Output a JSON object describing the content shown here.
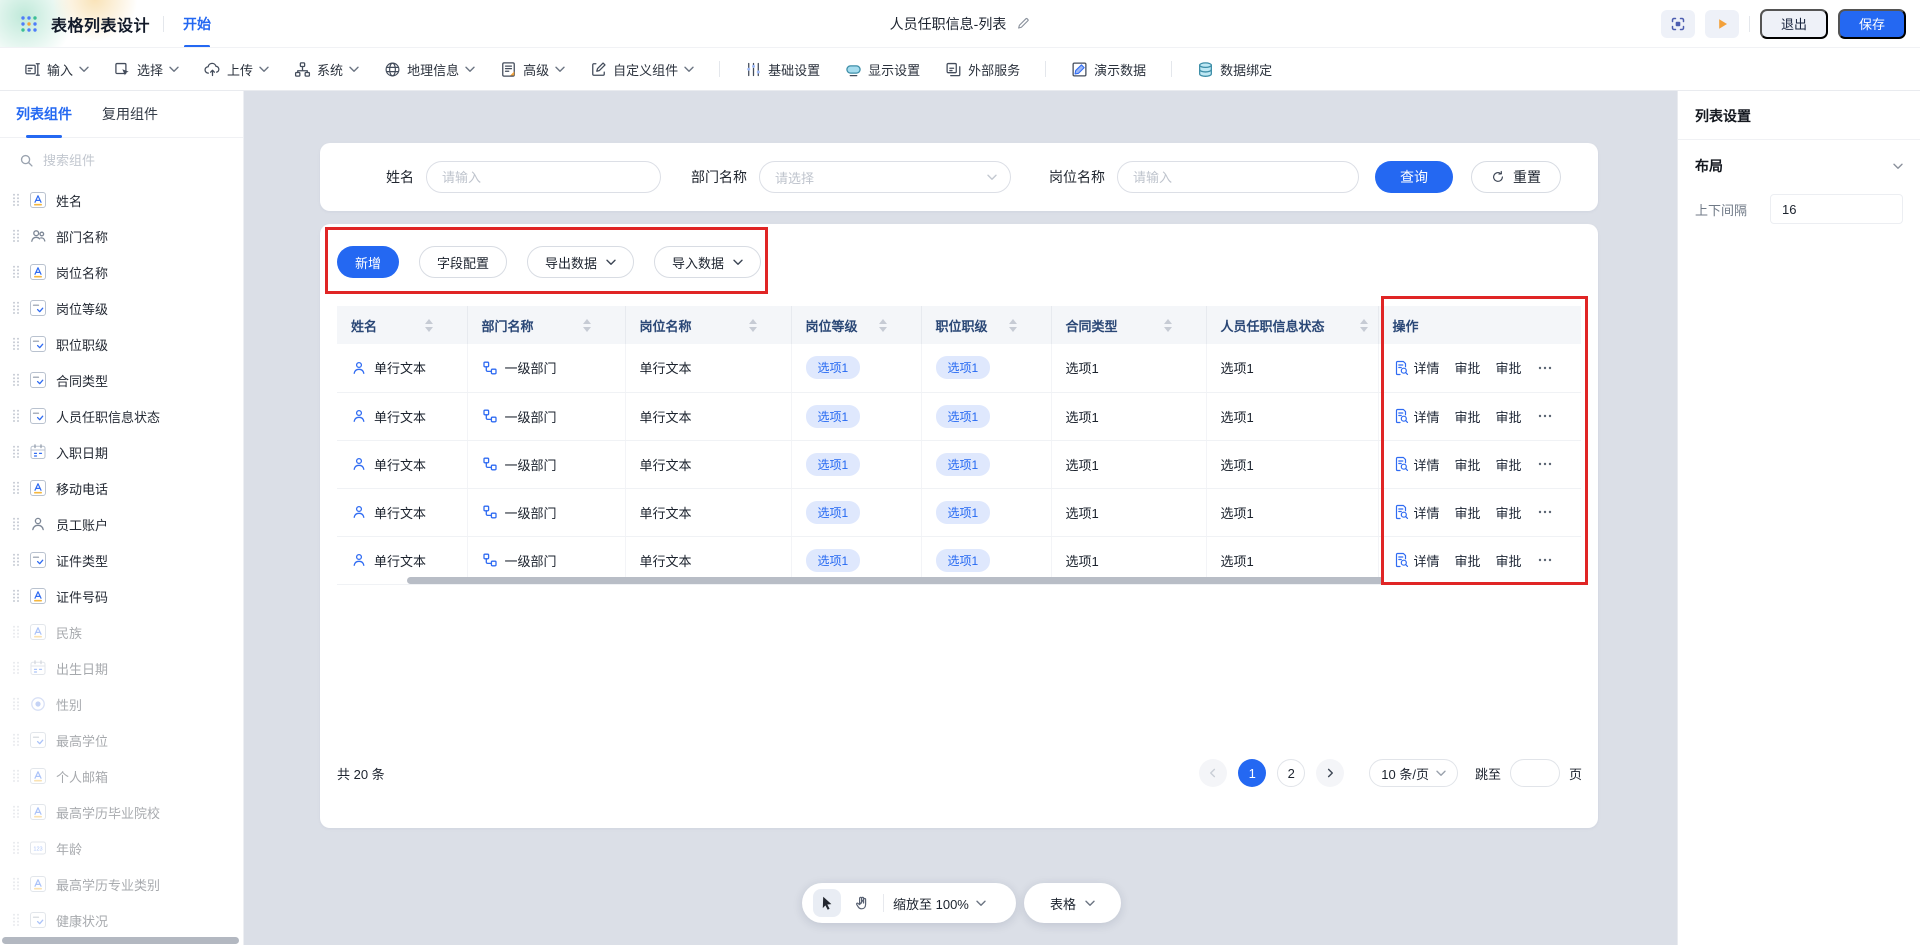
{
  "brand": {
    "app_title": "表格列表设计",
    "start_tab": "开始"
  },
  "header": {
    "doc_title": "人员任职信息-列表",
    "exit": "退出",
    "save": "保存"
  },
  "accent_color": "#2468f2",
  "annotation_color": "#e02525",
  "toolbar": {
    "items": [
      {
        "label": "输入",
        "icon": "t_input",
        "caret": true
      },
      {
        "label": "选择",
        "icon": "t_select",
        "caret": true
      },
      {
        "label": "上传",
        "icon": "t_upload",
        "caret": true
      },
      {
        "label": "系统",
        "icon": "t_system",
        "caret": true
      },
      {
        "label": "地理信息",
        "icon": "t_geo",
        "caret": true
      },
      {
        "label": "高级",
        "icon": "t_advanced",
        "caret": true
      },
      {
        "label": "自定义组件",
        "icon": "t_custom",
        "caret": true
      },
      {
        "label": "基础设置",
        "icon": "t_basic",
        "caret": false
      },
      {
        "label": "显示设置",
        "icon": "t_display",
        "caret": false
      },
      {
        "label": "外部服务",
        "icon": "t_external",
        "caret": false
      },
      {
        "label": "演示数据",
        "icon": "t_demo",
        "caret": false
      },
      {
        "label": "数据绑定",
        "icon": "t_databind",
        "caret": false
      }
    ]
  },
  "sidebar": {
    "tabs": [
      {
        "label": "列表组件",
        "active": true
      },
      {
        "label": "复用组件",
        "active": false
      }
    ],
    "search_placeholder": "搜索组件",
    "items": [
      {
        "label": "姓名",
        "icon": "text",
        "disabled": false
      },
      {
        "label": "部门名称",
        "icon": "people",
        "disabled": false
      },
      {
        "label": "岗位名称",
        "icon": "text",
        "disabled": false
      },
      {
        "label": "岗位等级",
        "icon": "select",
        "disabled": false
      },
      {
        "label": "职位职级",
        "icon": "select",
        "disabled": false
      },
      {
        "label": "合同类型",
        "icon": "select",
        "disabled": false
      },
      {
        "label": "人员任职信息状态",
        "icon": "select",
        "disabled": false
      },
      {
        "label": "入职日期",
        "icon": "date",
        "disabled": false
      },
      {
        "label": "移动电话",
        "icon": "text",
        "disabled": false
      },
      {
        "label": "员工账户",
        "icon": "person",
        "disabled": false
      },
      {
        "label": "证件类型",
        "icon": "select",
        "disabled": false
      },
      {
        "label": "证件号码",
        "icon": "text",
        "disabled": false
      },
      {
        "label": "民族",
        "icon": "text",
        "disabled": true
      },
      {
        "label": "出生日期",
        "icon": "date",
        "disabled": true
      },
      {
        "label": "性别",
        "icon": "radio",
        "disabled": true
      },
      {
        "label": "最高学位",
        "icon": "select",
        "disabled": true
      },
      {
        "label": "个人邮箱",
        "icon": "text",
        "disabled": true
      },
      {
        "label": "最高学历毕业院校",
        "icon": "text",
        "disabled": true
      },
      {
        "label": "年龄",
        "icon": "number",
        "disabled": true
      },
      {
        "label": "最高学历专业类别",
        "icon": "text",
        "disabled": true
      },
      {
        "label": "健康状况",
        "icon": "select",
        "disabled": true
      }
    ]
  },
  "search_form": {
    "fields": [
      {
        "label": "姓名",
        "placeholder": "请输入",
        "type": "input"
      },
      {
        "label": "部门名称",
        "placeholder": "请选择",
        "type": "select"
      },
      {
        "label": "岗位名称",
        "placeholder": "请输入",
        "type": "input"
      }
    ],
    "query": "查询",
    "reset": "重置"
  },
  "actions_bar": {
    "add": "新增",
    "field_config": "字段配置",
    "export": "导出数据",
    "import": "导入数据"
  },
  "table": {
    "columns": [
      {
        "label": "姓名",
        "sortable": true
      },
      {
        "label": "部门名称",
        "sortable": true
      },
      {
        "label": "岗位名称",
        "sortable": true
      },
      {
        "label": "岗位等级",
        "sortable": true
      },
      {
        "label": "职位职级",
        "sortable": true
      },
      {
        "label": "合同类型",
        "sortable": true
      },
      {
        "label": "人员任职信息状态",
        "sortable": true
      },
      {
        "label": "操作",
        "sortable": false
      }
    ],
    "rows": [
      {
        "name": "单行文本",
        "dept": "一级部门",
        "post": "单行文本",
        "grade": "选项1",
        "rank": "选项1",
        "contract": "选项1",
        "status": "选项1",
        "actions": [
          "详情",
          "审批",
          "审批"
        ]
      },
      {
        "name": "单行文本",
        "dept": "一级部门",
        "post": "单行文本",
        "grade": "选项1",
        "rank": "选项1",
        "contract": "选项1",
        "status": "选项1",
        "actions": [
          "详情",
          "审批",
          "审批"
        ]
      },
      {
        "name": "单行文本",
        "dept": "一级部门",
        "post": "单行文本",
        "grade": "选项1",
        "rank": "选项1",
        "contract": "选项1",
        "status": "选项1",
        "actions": [
          "详情",
          "审批",
          "审批"
        ]
      },
      {
        "name": "单行文本",
        "dept": "一级部门",
        "post": "单行文本",
        "grade": "选项1",
        "rank": "选项1",
        "contract": "选项1",
        "status": "选项1",
        "actions": [
          "详情",
          "审批",
          "审批"
        ]
      },
      {
        "name": "单行文本",
        "dept": "一级部门",
        "post": "单行文本",
        "grade": "选项1",
        "rank": "选项1",
        "contract": "选项1",
        "status": "选项1",
        "actions": [
          "详情",
          "审批",
          "审批"
        ]
      }
    ]
  },
  "pagination": {
    "total": "共 20 条",
    "pages": [
      "1",
      "2"
    ],
    "active_page": "1",
    "page_size": "10 条/页",
    "jump": "跳至",
    "unit": "页"
  },
  "canvas_bar": {
    "zoom": "缩放至 100%",
    "widget": "表格"
  },
  "settings": {
    "title": "列表设置",
    "section": "布局",
    "spacing_label": "上下间隔",
    "spacing_value": "16"
  }
}
